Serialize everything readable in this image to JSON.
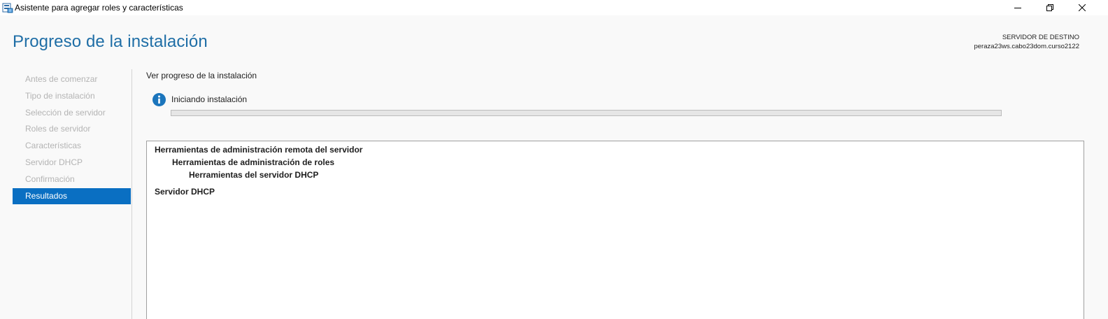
{
  "window": {
    "title": "Asistente para agregar roles y características",
    "icons": [
      "server-manager-icon",
      "minimize-icon",
      "restore-icon",
      "close-icon"
    ]
  },
  "header": {
    "page_title": "Progreso de la instalación",
    "destination_label": "SERVIDOR DE DESTINO",
    "destination_server": "peraza23ws.cabo23dom.curso2122"
  },
  "sidebar": {
    "items": [
      {
        "label": "Antes de comenzar",
        "active": false
      },
      {
        "label": "Tipo de instalación",
        "active": false
      },
      {
        "label": "Selección de servidor",
        "active": false
      },
      {
        "label": "Roles de servidor",
        "active": false
      },
      {
        "label": "Características",
        "active": false
      },
      {
        "label": "Servidor DHCP",
        "active": false
      },
      {
        "label": "Confirmación",
        "active": false
      },
      {
        "label": "Resultados",
        "active": true
      }
    ]
  },
  "main": {
    "section_title": "Ver progreso de la instalación",
    "status_icon": "info-icon",
    "status_text": "Iniciando instalación",
    "progress": 0,
    "results": [
      {
        "text": "Herramientas de administración remota del servidor",
        "level": 0
      },
      {
        "text": "Herramientas de administración de roles",
        "level": 1
      },
      {
        "text": "Herramientas del servidor DHCP",
        "level": 2
      },
      {
        "text": "Servidor DHCP",
        "level": 0
      }
    ]
  },
  "colors": {
    "accent": "#0a6fc2",
    "title_blue": "#1f6ea6",
    "info_blue": "#1b75bc",
    "disabled_text": "#b4b4b4"
  }
}
